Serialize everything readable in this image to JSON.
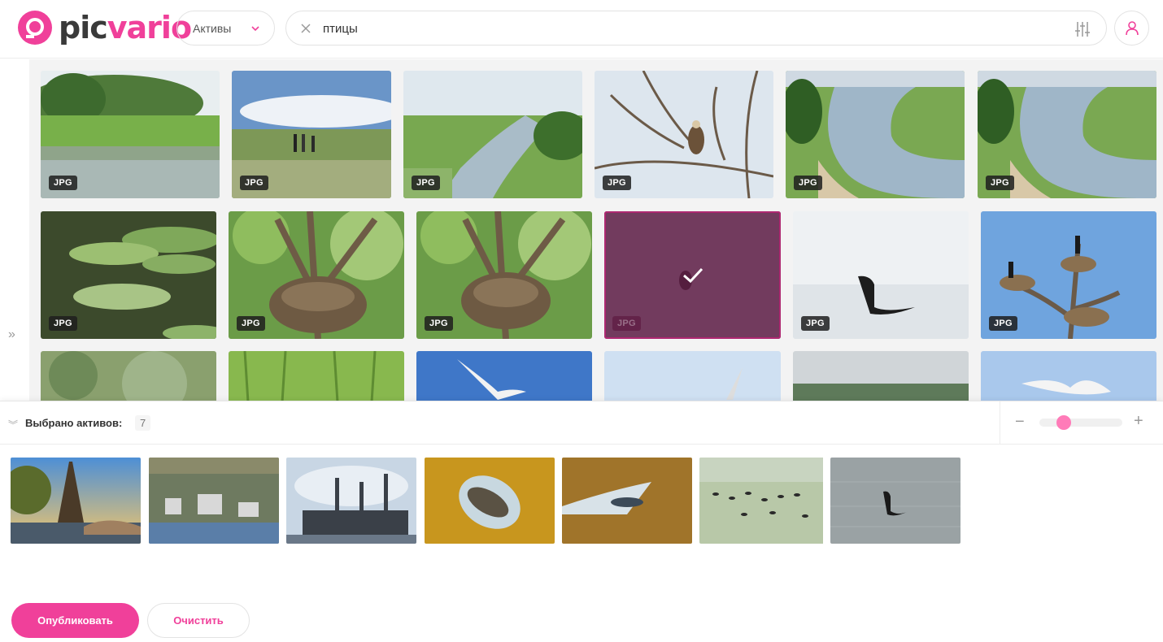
{
  "brand": {
    "pic": "pic",
    "vario": "vario",
    "accent": "#f0409a"
  },
  "header": {
    "asset_select": "Активы",
    "search_value": "птицы",
    "icons": {
      "clear": "close-icon",
      "filter": "sliders-icon",
      "user": "user-icon",
      "dropdown": "chevron-down-icon"
    }
  },
  "grid": {
    "rows": [
      [
        {
          "badge": "JPG",
          "scene": "river-reeds"
        },
        {
          "badge": "JPG",
          "scene": "meadow-people"
        },
        {
          "badge": "JPG",
          "scene": "river-bend"
        },
        {
          "badge": "JPG",
          "scene": "eagle-branches"
        },
        {
          "badge": "JPG",
          "scene": "river-aerial"
        },
        {
          "badge": "JPG",
          "scene": "river-aerial"
        }
      ],
      [
        {
          "badge": "JPG",
          "scene": "lily-pads"
        },
        {
          "badge": "JPG",
          "scene": "nest-tree"
        },
        {
          "badge": "JPG",
          "scene": "nest-tree"
        },
        {
          "badge": "JPG",
          "scene": "water-bird",
          "selected": true
        },
        {
          "badge": "JPG",
          "scene": "cormorant-water"
        },
        {
          "badge": "JPG",
          "scene": "cormorant-nests"
        }
      ],
      [
        {
          "scene": "bushes"
        },
        {
          "scene": "grass"
        },
        {
          "scene": "gull-sky"
        },
        {
          "scene": "sky-bird"
        },
        {
          "scene": "shore-birds"
        },
        {
          "scene": "gull-sky-light"
        }
      ]
    ]
  },
  "panel": {
    "label": "Выбрано активов:",
    "count": "7",
    "zoom": {
      "level": 0.25,
      "minus": "−",
      "plus": "+"
    },
    "selected": [
      "eiffel",
      "town",
      "factory",
      "sat-yellow",
      "sat-brown",
      "geese",
      "cormorant"
    ],
    "publish": "Опубликовать",
    "clear": "Очистить"
  }
}
